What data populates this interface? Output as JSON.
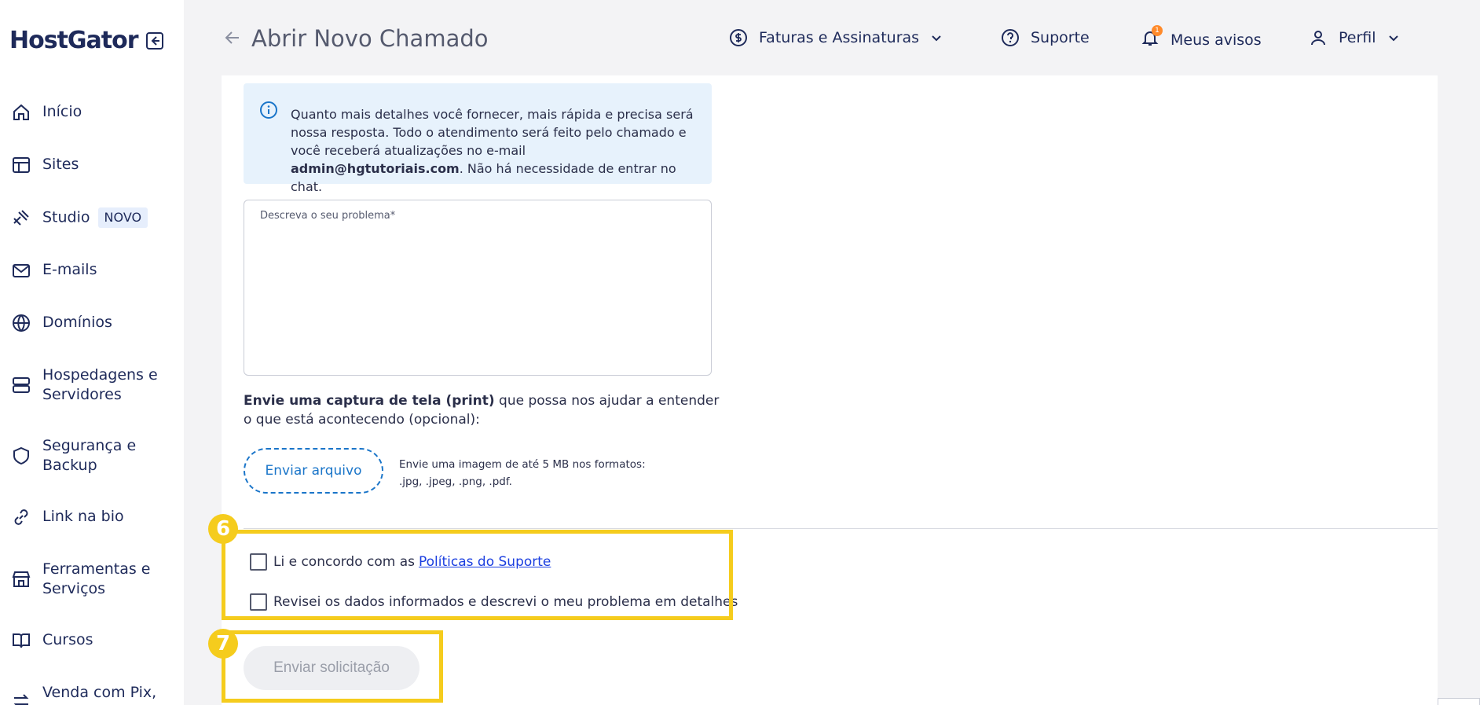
{
  "brand": {
    "logo": "HostGator"
  },
  "sidebar": {
    "items": [
      {
        "label": "Início",
        "icon": "home-icon"
      },
      {
        "label": "Sites",
        "icon": "layout-icon"
      },
      {
        "label": "Studio",
        "badge": "NOVO",
        "icon": "studio-icon"
      },
      {
        "label": "E-mails",
        "icon": "mail-icon"
      },
      {
        "label": "Domínios",
        "icon": "globe-icon"
      },
      {
        "label": "Hospedagens e Servidores",
        "icon": "server-icon"
      },
      {
        "label": "Segurança e Backup",
        "icon": "shield-icon"
      },
      {
        "label": "Link na bio",
        "icon": "link-icon"
      },
      {
        "label": "Ferramentas e Serviços",
        "icon": "store-icon"
      },
      {
        "label": "Cursos",
        "icon": "book-icon"
      },
      {
        "label": "Venda com Pix,",
        "icon": "transfer-icon"
      }
    ]
  },
  "header": {
    "title": "Abrir Novo Chamado",
    "billing": "Faturas e Assinaturas",
    "support": "Suporte",
    "notices": "Meus avisos",
    "notices_count": "1",
    "profile": "Perfil"
  },
  "form": {
    "info_before": "Quanto mais detalhes você fornecer, mais rápida e precisa será nossa resposta. Todo o atendimento será feito pelo chamado e você receberá atualizações no e-mail ",
    "info_email": "admin@hgtutoriais.com",
    "info_after": ". Não há necessidade de entrar no chat.",
    "problem_placeholder": "Descreva o seu problema*",
    "upload_bold": "Envie uma captura de tela (print)",
    "upload_rest": " que possa nos ajudar a entender o que está acontecendo (opcional):",
    "upload_button": "Enviar arquivo",
    "upload_hint_1": "Envie uma imagem de até 5 MB nos formatos:",
    "upload_hint_2": ".jpg, .jpeg, .png, .pdf.",
    "check1_text": "Li e concordo com as",
    "check1_link": "Políticas do Suporte",
    "check2_text": "Revisei os dados informados e descrevi o meu problema em detalhes",
    "submit": "Enviar solicitação"
  },
  "annotations": {
    "step6": "6",
    "step7": "7",
    "highlight_color": "#f5cc1d"
  },
  "colors": {
    "accent": "#1a75c9",
    "brand": "#1e2a5a",
    "notice": "#ff8a2a"
  }
}
